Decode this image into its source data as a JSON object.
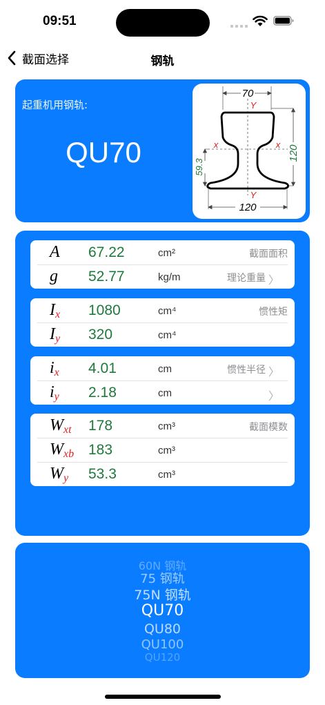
{
  "status_bar": {
    "time": "09:51"
  },
  "nav": {
    "back_label": "截面选择",
    "title": "钢轨"
  },
  "header": {
    "category": "起重机用钢轨:",
    "name": "QU70",
    "diagram": {
      "top_width": "70",
      "bottom_width": "120",
      "height": "120",
      "neutral_height": "59.3",
      "axis_x": "x",
      "axis_y": "Y"
    }
  },
  "groups": [
    {
      "rows": [
        {
          "sym": "A",
          "sub": "",
          "value": "67.22",
          "unit": "cm²",
          "desc": "截面面积",
          "chevron": false
        },
        {
          "sym": "g",
          "sub": "",
          "value": "52.77",
          "unit": "kg/m",
          "desc": "理论重量",
          "chevron": true
        }
      ]
    },
    {
      "rows": [
        {
          "sym": "I",
          "sub": "x",
          "value": "1080",
          "unit": "cm⁴",
          "desc": "惯性矩",
          "chevron": false
        },
        {
          "sym": "I",
          "sub": "y",
          "value": "320",
          "unit": "cm⁴",
          "desc": "",
          "chevron": false
        }
      ]
    },
    {
      "rows": [
        {
          "sym": "i",
          "sub": "x",
          "value": "4.01",
          "unit": "cm",
          "desc": "惯性半径",
          "chevron": true
        },
        {
          "sym": "i",
          "sub": "y",
          "value": "2.18",
          "unit": "cm",
          "desc": "",
          "chevron": true
        }
      ]
    },
    {
      "rows": [
        {
          "sym": "W",
          "sub": "xt",
          "value": "178",
          "unit": "cm³",
          "desc": "截面模数",
          "chevron": false
        },
        {
          "sym": "W",
          "sub": "xb",
          "value": "183",
          "unit": "cm³",
          "desc": "",
          "chevron": false
        },
        {
          "sym": "W",
          "sub": "y",
          "value": "53.3",
          "unit": "cm³",
          "desc": "",
          "chevron": false
        }
      ]
    }
  ],
  "picker": {
    "options": [
      "60N 钢轨",
      "75 钢轨",
      "75N 钢轨",
      "QU70",
      "QU80",
      "QU100",
      "QU120"
    ],
    "selected_index": 3
  },
  "colors": {
    "accent": "#0a7cff",
    "value": "#1d7a3a",
    "subscript": "#e02020",
    "dimension": "#1d7a3a",
    "axis": "#e02020"
  },
  "icons": {
    "back": "chevron-left-icon",
    "row_more": "chevron-right-icon"
  }
}
